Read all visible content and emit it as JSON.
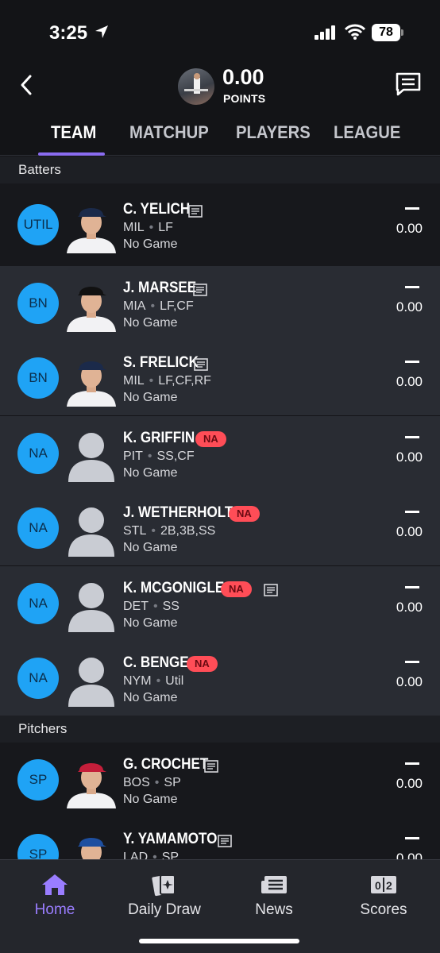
{
  "status_bar": {
    "time": "3:25",
    "battery": "78"
  },
  "header": {
    "points_value": "0.00",
    "points_label": "POINTS"
  },
  "tabs": [
    {
      "label": "TEAM"
    },
    {
      "label": "MATCHUP"
    },
    {
      "label": "PLAYERS"
    },
    {
      "label": "LEAGUE"
    }
  ],
  "sections": {
    "batters": "Batters",
    "pitchers": "Pitchers"
  },
  "players": [
    {
      "pos": "UTIL",
      "name": "C. YELICH",
      "team": "MIL",
      "elig": "LF",
      "game": "No Game",
      "points": "0.00",
      "na": ""
    },
    {
      "pos": "BN",
      "name": "J. MARSEE",
      "team": "MIA",
      "elig": "LF,CF",
      "game": "No Game",
      "points": "0.00",
      "na": ""
    },
    {
      "pos": "BN",
      "name": "S. FRELICK",
      "team": "MIL",
      "elig": "LF,CF,RF",
      "game": "No Game",
      "points": "0.00",
      "na": ""
    },
    {
      "pos": "NA",
      "name": "K. GRIFFIN",
      "team": "PIT",
      "elig": "SS,CF",
      "game": "No Game",
      "points": "0.00",
      "na": "NA"
    },
    {
      "pos": "NA",
      "name": "J. WETHERHOLT",
      "team": "STL",
      "elig": "2B,3B,SS",
      "game": "No Game",
      "points": "0.00",
      "na": "NA"
    },
    {
      "pos": "NA",
      "name": "K. MCGONIGLE",
      "team": "DET",
      "elig": "SS",
      "game": "No Game",
      "points": "0.00",
      "na": "NA"
    },
    {
      "pos": "NA",
      "name": "C. BENGE",
      "team": "NYM",
      "elig": "Util",
      "game": "No Game",
      "points": "0.00",
      "na": "NA"
    },
    {
      "pos": "SP",
      "name": "G. CROCHET",
      "team": "BOS",
      "elig": "SP",
      "game": "No Game",
      "points": "0.00",
      "na": ""
    },
    {
      "pos": "SP",
      "name": "Y. YAMAMOTO",
      "team": "LAD",
      "elig": "SP",
      "game": "",
      "points": "0.00",
      "na": ""
    }
  ],
  "nav": [
    {
      "label": "Home",
      "icon": "home-icon"
    },
    {
      "label": "Daily Draw",
      "icon": "daily-draw-icon"
    },
    {
      "label": "News",
      "icon": "news-icon"
    },
    {
      "label": "Scores",
      "icon": "scores-icon"
    }
  ],
  "colors": {
    "accent": "#8a6cf0",
    "position_badge": "#1fa3f5",
    "na_badge": "#ff4d57",
    "background": "#131417"
  }
}
